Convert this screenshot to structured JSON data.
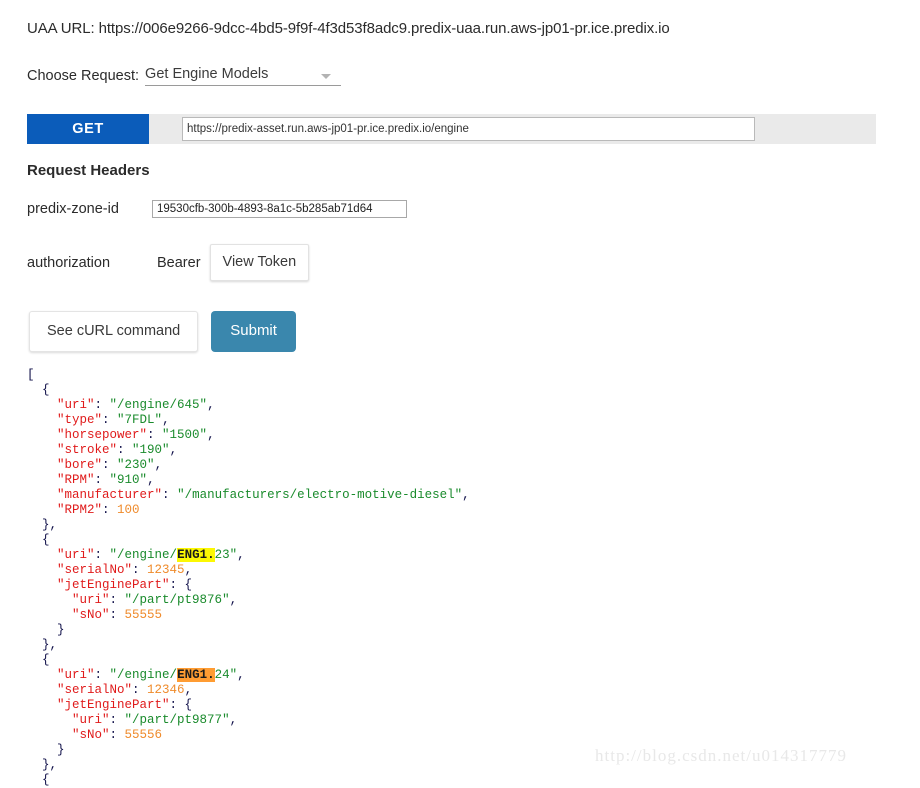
{
  "header": {
    "uaa_url_line": "UAA URL: https://006e9266-9dcc-4bd5-9f9f-4f3d53f8adc9.predix-uaa.run.aws-jp01-pr.ice.predix.io"
  },
  "request_selector": {
    "label": "Choose Request:",
    "selected": "Get Engine Models",
    "arrow_icon": "chevron-down-icon"
  },
  "request_bar": {
    "method": "GET",
    "method_color": "#0b5cba",
    "url_value": "https://predix-asset.run.aws-jp01-pr.ice.predix.io/engine",
    "url_placeholder": "Enter request URL"
  },
  "request_headers": {
    "title": "Request Headers",
    "rows": [
      {
        "name": "predix-zone-id",
        "value": "19530cfb-300b-4893-8a1c-5b285ab71d64",
        "placeholder": "predix-zone-id"
      },
      {
        "name": "authorization",
        "scheme": "Bearer",
        "token_button": "View Token"
      }
    ]
  },
  "actions": {
    "curl_label": "See cURL command",
    "submit_label": "Submit",
    "submit_color": "#3a87ad"
  },
  "response": {
    "highlight_yellow": "#fcf803",
    "highlight_orange": "#ff9c32",
    "lines": [
      {
        "indent": 0,
        "segments": [
          {
            "t": "[",
            "c": "p"
          }
        ]
      },
      {
        "indent": 1,
        "segments": [
          {
            "t": "{",
            "c": "p"
          }
        ]
      },
      {
        "indent": 2,
        "segments": [
          {
            "t": "\"uri\"",
            "c": "k"
          },
          {
            "t": ": ",
            "c": "p"
          },
          {
            "t": "\"/engine/645\"",
            "c": "s"
          },
          {
            "t": ",",
            "c": "p"
          }
        ]
      },
      {
        "indent": 2,
        "segments": [
          {
            "t": "\"type\"",
            "c": "k"
          },
          {
            "t": ": ",
            "c": "p"
          },
          {
            "t": "\"7FDL\"",
            "c": "s"
          },
          {
            "t": ",",
            "c": "p"
          }
        ]
      },
      {
        "indent": 2,
        "segments": [
          {
            "t": "\"horsepower\"",
            "c": "k"
          },
          {
            "t": ": ",
            "c": "p"
          },
          {
            "t": "\"1500\"",
            "c": "s"
          },
          {
            "t": ",",
            "c": "p"
          }
        ]
      },
      {
        "indent": 2,
        "segments": [
          {
            "t": "\"stroke\"",
            "c": "k"
          },
          {
            "t": ": ",
            "c": "p"
          },
          {
            "t": "\"190\"",
            "c": "s"
          },
          {
            "t": ",",
            "c": "p"
          }
        ]
      },
      {
        "indent": 2,
        "segments": [
          {
            "t": "\"bore\"",
            "c": "k"
          },
          {
            "t": ": ",
            "c": "p"
          },
          {
            "t": "\"230\"",
            "c": "s"
          },
          {
            "t": ",",
            "c": "p"
          }
        ]
      },
      {
        "indent": 2,
        "segments": [
          {
            "t": "\"RPM\"",
            "c": "k"
          },
          {
            "t": ": ",
            "c": "p"
          },
          {
            "t": "\"910\"",
            "c": "s"
          },
          {
            "t": ",",
            "c": "p"
          }
        ]
      },
      {
        "indent": 2,
        "segments": [
          {
            "t": "\"manufacturer\"",
            "c": "k"
          },
          {
            "t": ": ",
            "c": "p"
          },
          {
            "t": "\"/manufacturers/electro-motive-diesel\"",
            "c": "s"
          },
          {
            "t": ",",
            "c": "p"
          }
        ]
      },
      {
        "indent": 2,
        "segments": [
          {
            "t": "\"RPM2\"",
            "c": "k"
          },
          {
            "t": ": ",
            "c": "p"
          },
          {
            "t": "100",
            "c": "n"
          }
        ]
      },
      {
        "indent": 1,
        "segments": [
          {
            "t": "},",
            "c": "p"
          }
        ]
      },
      {
        "indent": 1,
        "segments": [
          {
            "t": "{",
            "c": "p"
          }
        ]
      },
      {
        "indent": 2,
        "segments": [
          {
            "t": "\"uri\"",
            "c": "k"
          },
          {
            "t": ": ",
            "c": "p"
          },
          {
            "t": "\"/engine/",
            "c": "s"
          },
          {
            "t": "ENG1.",
            "c": "hl-y"
          },
          {
            "t": "23\"",
            "c": "s"
          },
          {
            "t": ",",
            "c": "p"
          }
        ]
      },
      {
        "indent": 2,
        "segments": [
          {
            "t": "\"serialNo\"",
            "c": "k"
          },
          {
            "t": ": ",
            "c": "p"
          },
          {
            "t": "12345",
            "c": "n"
          },
          {
            "t": ",",
            "c": "p"
          }
        ]
      },
      {
        "indent": 2,
        "segments": [
          {
            "t": "\"jetEnginePart\"",
            "c": "k"
          },
          {
            "t": ": {",
            "c": "p"
          }
        ]
      },
      {
        "indent": 3,
        "segments": [
          {
            "t": "\"uri\"",
            "c": "k"
          },
          {
            "t": ": ",
            "c": "p"
          },
          {
            "t": "\"/part/pt9876\"",
            "c": "s"
          },
          {
            "t": ",",
            "c": "p"
          }
        ]
      },
      {
        "indent": 3,
        "segments": [
          {
            "t": "\"sNo\"",
            "c": "k"
          },
          {
            "t": ": ",
            "c": "p"
          },
          {
            "t": "55555",
            "c": "n"
          }
        ]
      },
      {
        "indent": 2,
        "segments": [
          {
            "t": "}",
            "c": "p"
          }
        ]
      },
      {
        "indent": 1,
        "segments": [
          {
            "t": "},",
            "c": "p"
          }
        ]
      },
      {
        "indent": 1,
        "segments": [
          {
            "t": "{",
            "c": "p"
          }
        ]
      },
      {
        "indent": 2,
        "segments": [
          {
            "t": "\"uri\"",
            "c": "k"
          },
          {
            "t": ": ",
            "c": "p"
          },
          {
            "t": "\"/engine/",
            "c": "s"
          },
          {
            "t": "ENG1.",
            "c": "hl-o"
          },
          {
            "t": "24\"",
            "c": "s"
          },
          {
            "t": ",",
            "c": "p"
          }
        ]
      },
      {
        "indent": 2,
        "segments": [
          {
            "t": "\"serialNo\"",
            "c": "k"
          },
          {
            "t": ": ",
            "c": "p"
          },
          {
            "t": "12346",
            "c": "n"
          },
          {
            "t": ",",
            "c": "p"
          }
        ]
      },
      {
        "indent": 2,
        "segments": [
          {
            "t": "\"jetEnginePart\"",
            "c": "k"
          },
          {
            "t": ": {",
            "c": "p"
          }
        ]
      },
      {
        "indent": 3,
        "segments": [
          {
            "t": "\"uri\"",
            "c": "k"
          },
          {
            "t": ": ",
            "c": "p"
          },
          {
            "t": "\"/part/pt9877\"",
            "c": "s"
          },
          {
            "t": ",",
            "c": "p"
          }
        ]
      },
      {
        "indent": 3,
        "segments": [
          {
            "t": "\"sNo\"",
            "c": "k"
          },
          {
            "t": ": ",
            "c": "p"
          },
          {
            "t": "55556",
            "c": "n"
          }
        ]
      },
      {
        "indent": 2,
        "segments": [
          {
            "t": "}",
            "c": "p"
          }
        ]
      },
      {
        "indent": 1,
        "segments": [
          {
            "t": "},",
            "c": "p"
          }
        ]
      },
      {
        "indent": 1,
        "segments": [
          {
            "t": "{",
            "c": "p"
          }
        ]
      }
    ]
  },
  "watermark": {
    "text": "http://blog.csdn.net/u014317779"
  }
}
